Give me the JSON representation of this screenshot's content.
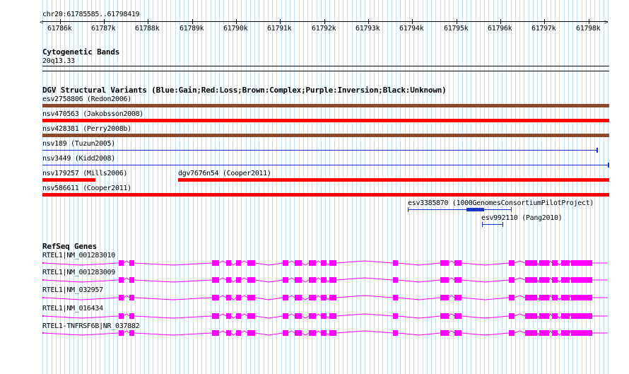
{
  "ruler": {
    "coordinates": "chr20:61785585..61798419",
    "ticks": [
      "61786k",
      "61787k",
      "61788k",
      "61789k",
      "61790k",
      "61791k",
      "61792k",
      "61793k",
      "61794k",
      "61795k",
      "61796k",
      "61797k",
      "61798k"
    ]
  },
  "cytoband": {
    "title": "Cytogenetic Bands",
    "band": "20q13.33"
  },
  "dgv": {
    "title": "DGV Structural Variants (Blue:Gain;Red:Loss;Brown:Complex;Purple:Inversion;Black:Unknown)",
    "colors": {
      "gain": "#1a33cc",
      "loss": "#ff0000",
      "complex": "#8b4a2b"
    },
    "variants": [
      {
        "label": "esv2758806 (Redon2006)",
        "type": "complex"
      },
      {
        "label": "nsv470563 (Jakobsson2008)",
        "type": "loss"
      },
      {
        "label": "nsv428381 (Perry2008b)",
        "type": "complex"
      },
      {
        "label": "nsv189 (Tuzun2005)",
        "type": "gain"
      },
      {
        "label": "nsv3449 (Kidd2008)",
        "type": "gain"
      },
      {
        "label": "nsv179257 (Mills2006)",
        "type": "loss"
      },
      {
        "label": "dgv7676n54 (Cooper2011)",
        "type": "loss"
      },
      {
        "label": "nsv586611 (Cooper2011)",
        "type": "loss"
      },
      {
        "label": "esv3385870 (1000GenomesConsortiumPilotProject)",
        "type": "gain"
      },
      {
        "label": "esv992110 (Pang2010)",
        "type": "gain"
      }
    ]
  },
  "refseq": {
    "title": "RefSeq Genes",
    "color": "#ff00ff",
    "genes": [
      {
        "label": "RTEL1|NM_001283010"
      },
      {
        "label": "RTEL1|NM_001283009"
      },
      {
        "label": "RTEL1|NM_032957"
      },
      {
        "label": "RTEL1|NM_016434"
      },
      {
        "label": "RTEL1-TNFRSF6B|NR_037882"
      }
    ]
  }
}
